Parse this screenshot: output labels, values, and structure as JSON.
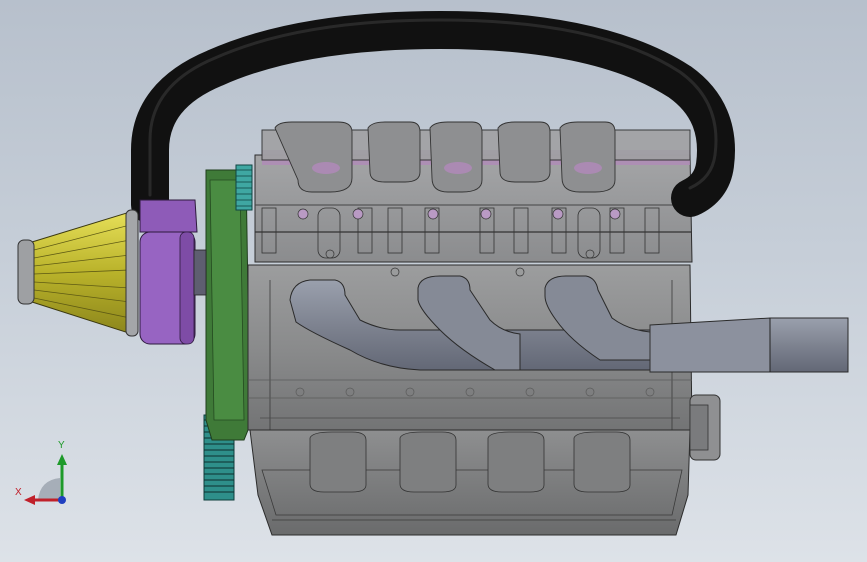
{
  "viewport": {
    "background_top": "#b7c0cc",
    "background_bottom": "#dde2e8"
  },
  "model": {
    "colors": {
      "hose": "#0d0d0d",
      "air_filter": "#d6cf3a",
      "intake_adapter": "#8e5bb8",
      "timing_cover": "#3f7f3a",
      "pulley": "#3fa7a2",
      "engine_block": "#8f9091",
      "exhaust_pipe": "#8a8f9c",
      "gasket_highlight": "#b08ab8"
    }
  },
  "triad": {
    "x_label": "X",
    "y_label": "Y",
    "x_color": "#c0202a",
    "y_color": "#1e9a2a",
    "z_color": "#1f3fc0",
    "icon": "coordinate-triad-icon"
  }
}
